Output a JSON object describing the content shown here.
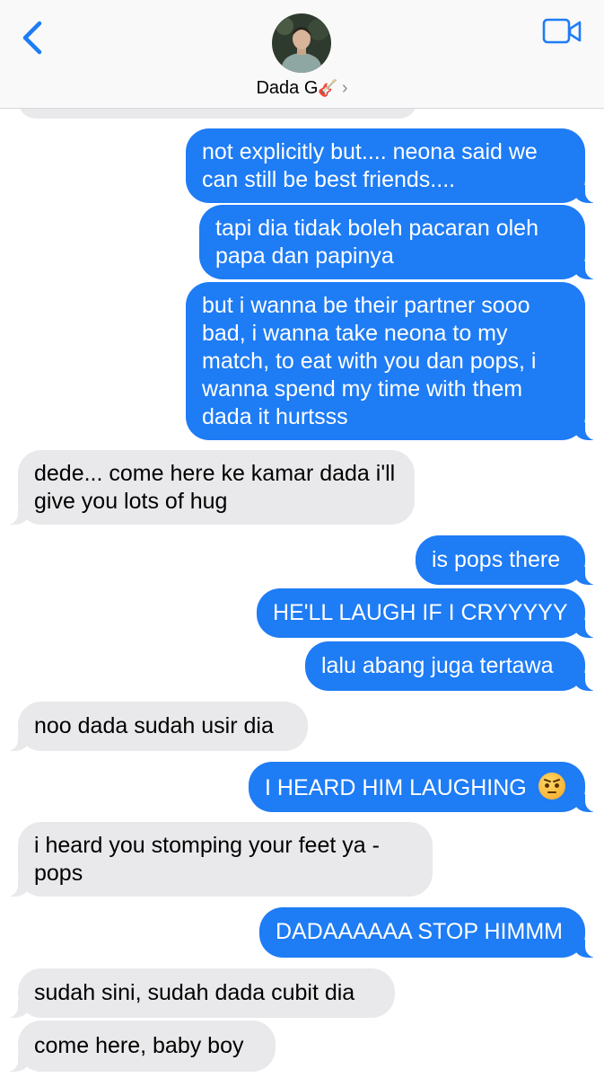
{
  "header": {
    "contact_name": "Dada G",
    "contact_emoji": "🎸",
    "back_icon": "chevron-left-icon",
    "video_icon": "video-camera-icon",
    "chevron": "›",
    "accent_color": "#1e7cf5"
  },
  "messages": [
    {
      "from": "me",
      "text": "not explicitly but.... neona said we can still be best friends...."
    },
    {
      "from": "me",
      "text": "tapi dia tidak boleh pacaran oleh papa dan papinya"
    },
    {
      "from": "me",
      "text": "but i wanna be their partner sooo bad, i wanna take neona to my match, to eat with you dan pops, i wanna spend my time with them dada it hurtsss"
    },
    {
      "from": "them",
      "text": "dede... come here ke kamar dada i'll give you lots of hug"
    },
    {
      "from": "me",
      "text": "is pops there"
    },
    {
      "from": "me",
      "text": "HE'LL LAUGH IF I CRYYYYY"
    },
    {
      "from": "me",
      "text": "lalu abang juga tertawa"
    },
    {
      "from": "them",
      "text": "noo dada sudah usir dia"
    },
    {
      "from": "me",
      "text": "I HEARD HIM LAUGHING",
      "emoji": "angry-face-icon"
    },
    {
      "from": "them",
      "text": "i heard you stomping your feet ya - pops"
    },
    {
      "from": "me",
      "text": "DADAAAAAA STOP HIMMM"
    },
    {
      "from": "them",
      "text": "sudah sini, sudah dada cubit dia"
    },
    {
      "from": "them",
      "text": "come here, baby boy"
    }
  ]
}
